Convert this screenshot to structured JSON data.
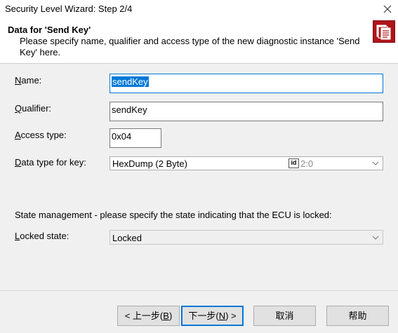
{
  "window": {
    "title": "Security Level Wizard: Step 2/4"
  },
  "header": {
    "title": "Data for 'Send Key'",
    "description": "Please specify name, qualifier and access type of the new diagnostic instance 'Send Key' here."
  },
  "form": {
    "name": {
      "label_u": "N",
      "label_rest": "ame:",
      "value": "sendKey"
    },
    "qualifier": {
      "label_u": "Q",
      "label_rest": "ualifier:",
      "value": "sendKey"
    },
    "access_type": {
      "label_u": "A",
      "label_rest": "ccess type:",
      "value": "0x04"
    },
    "data_type": {
      "label_pre": "",
      "label_u": "D",
      "label_rest": "ata type for key:",
      "value": "HexDump (2 Byte)",
      "id_badge": "id",
      "sub_value": "2:0"
    },
    "state_management_text": "State management - please specify the state indicating that the ECU is locked:",
    "locked_state": {
      "label_u": "L",
      "label_rest": "ocked state:",
      "value": "Locked"
    }
  },
  "buttons": {
    "back": {
      "pre": "< 上一步(",
      "u": "B",
      "post": ")"
    },
    "next": {
      "pre": "下一步(",
      "u": "N",
      "post": ") >"
    },
    "cancel": "取消",
    "help": "帮助"
  },
  "icons": {
    "close": "close-icon",
    "wizard": "documents-icon",
    "dropdown": "chevron-down-icon"
  },
  "colors": {
    "accent": "#0078d7",
    "icon_bg": "#b0141a"
  }
}
